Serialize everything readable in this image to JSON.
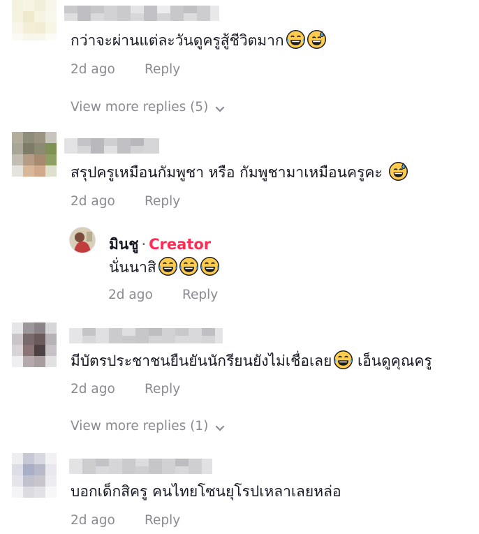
{
  "comments": [
    {
      "text": "กว่าจะผ่านแต่ละวันดูครูสู้ชีวิตมาก",
      "emojis": [
        "tears-of-joy-emoji",
        "sweat-smile-emoji"
      ],
      "time": "2d ago",
      "reply_label": "Reply",
      "more_replies": "View more replies (5)"
    },
    {
      "text": "สรุปครูเหมือนกัมพูชา หรือ กัมพูชามาเหมือนครูคะ",
      "emojis": [
        "sweat-smile-emoji"
      ],
      "time": "2d ago",
      "reply_label": "Reply"
    },
    {
      "text": "มีบัตรประชาชนยืนยันนักรียนยังไม่เชื่อเลย",
      "text_after": "เอ็นดูคุณครู",
      "emojis": [
        "tears-of-joy-emoji"
      ],
      "time": "2d ago",
      "reply_label": "Reply",
      "more_replies": "View more replies (1)"
    },
    {
      "text": "บอกเด็กสิครู คนไทยโซนยุโรปเหลาเลยหล่อ",
      "time": "2d ago",
      "reply_label": "Reply"
    }
  ],
  "creator_reply": {
    "name": "มินชู",
    "separator": "·",
    "badge": "Creator",
    "text": "นั่นนาสิ",
    "emojis": [
      "tears-of-joy-emoji",
      "tears-of-joy-emoji",
      "tears-of-joy-emoji"
    ],
    "time": "2d ago",
    "reply_label": "Reply"
  },
  "colors": {
    "text": "#161823",
    "muted": "#8a8b91",
    "creator_badge": "#fe2c55",
    "emoji_face": "#ffcc4d",
    "emoji_tear": "#5dadec"
  }
}
